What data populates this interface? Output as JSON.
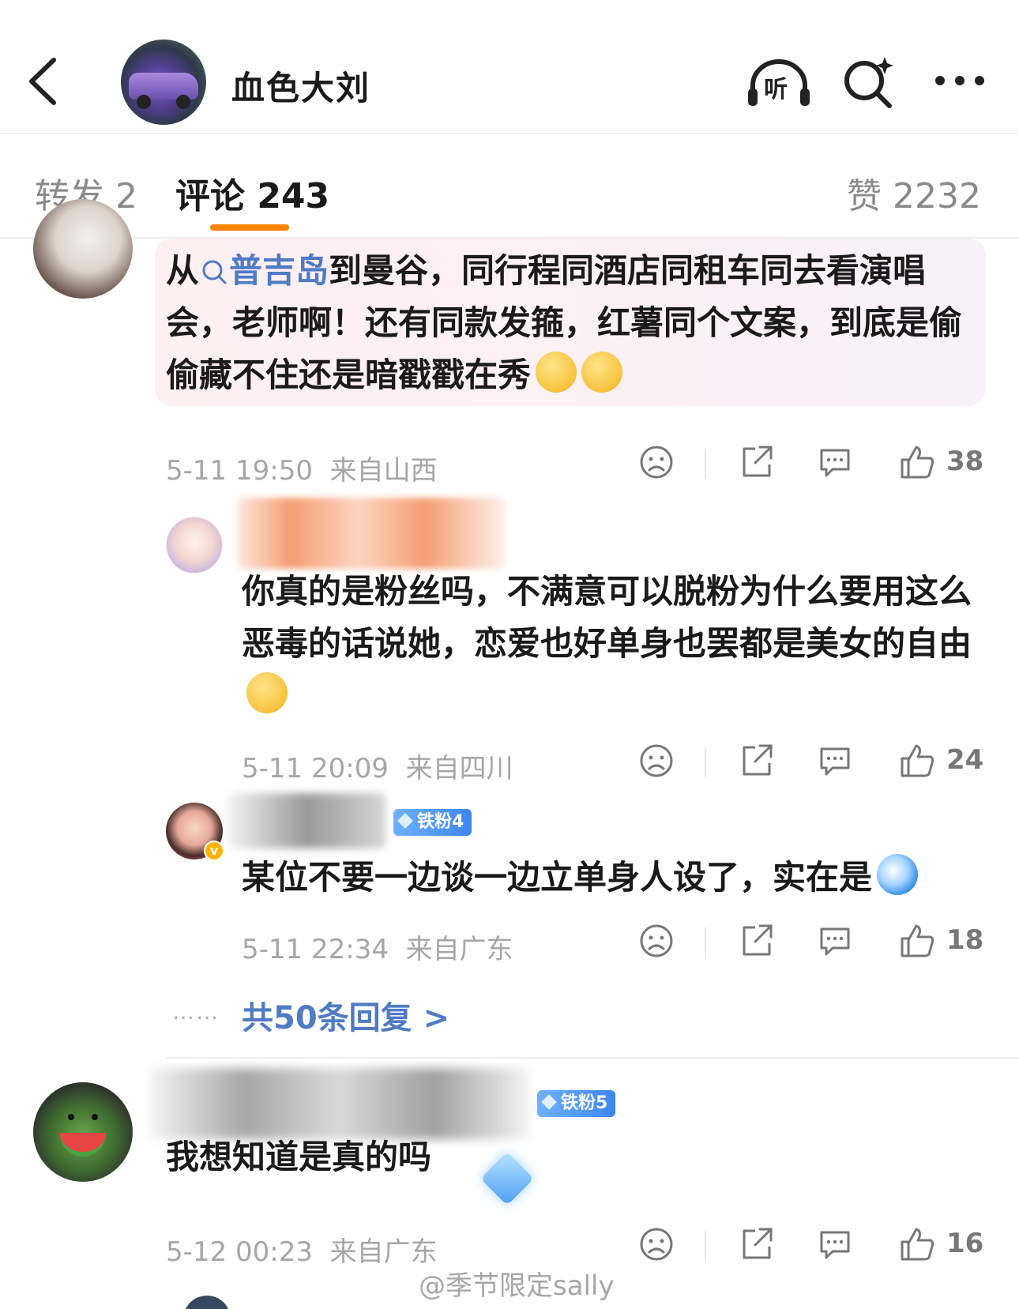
{
  "header": {
    "blog_name": "血色大刘",
    "listen_label": "听",
    "icons": [
      "back-arrow-icon",
      "headphones-icon",
      "search-sparkle-icon",
      "more-dots-icon"
    ]
  },
  "tabs": {
    "repost": "转发 2",
    "comment": "评论 243",
    "like": "赞 2232",
    "indicator_color": "#ff8200"
  },
  "colors": {
    "topic_link": "#4f7bc4",
    "meta_gray": "#a6a6a6",
    "highlight_bg": "#fdf0f3",
    "fan_badge": "#3d86f0"
  },
  "comments": [
    {
      "text_before": "从",
      "topic": "普吉岛",
      "text_after": "到曼谷，同行程同酒店同租车同去看演唱会，老师啊！还有同款发箍，红薯同个文案，到底是偷偷藏不住还是暗戳戳在秀",
      "time": "5-11 19:50",
      "location": "来自山西",
      "likes": "38"
    },
    {
      "text": "你真的是粉丝吗，不满意可以脱粉为什么要用这么恶毒的话说她，恋爱也好单身也罢都是美女的自由",
      "time": "5-11 20:09",
      "location": "来自四川",
      "likes": "24"
    },
    {
      "badge": "铁粉4",
      "text": "某位不要一边谈一边立单身人设了，实在是",
      "time": "5-11 22:34",
      "location": "来自广东",
      "likes": "18"
    },
    {
      "badge": "铁粉5",
      "text": "我想知道是真的吗",
      "time": "5-12 00:23",
      "location": "来自广东",
      "likes": "16"
    }
  ],
  "replies": {
    "dots": "……",
    "link": "共50条回复 >"
  },
  "watermark": "@季节限定sally"
}
